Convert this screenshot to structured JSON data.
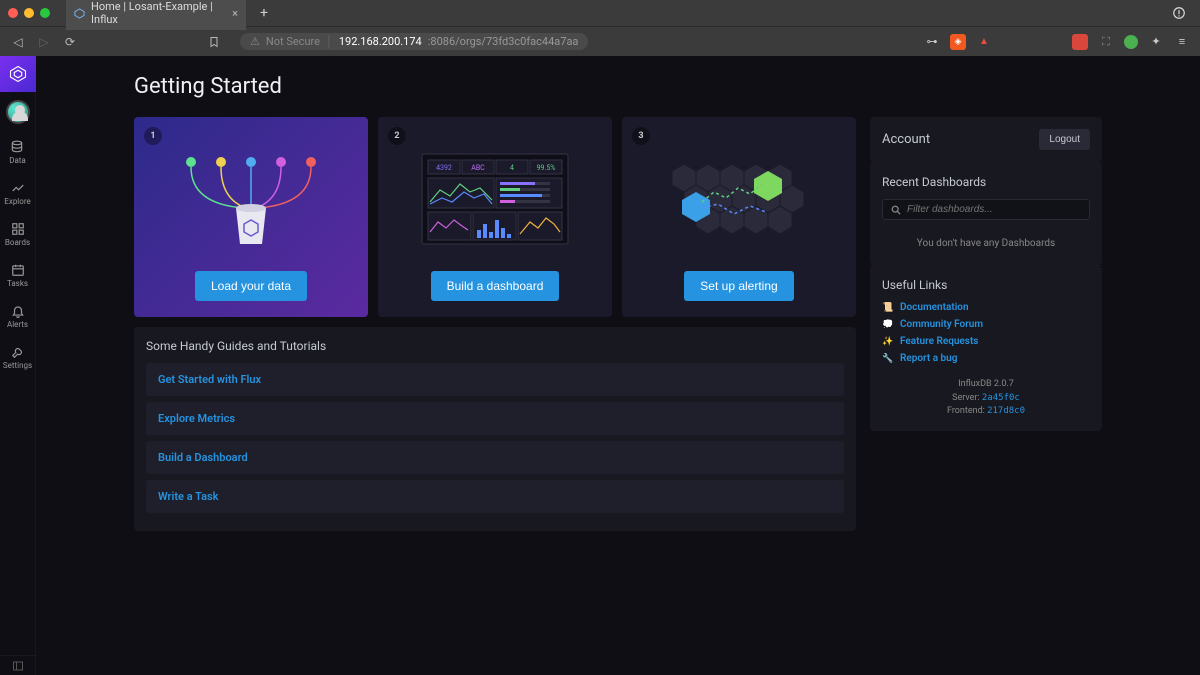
{
  "browser": {
    "tab_title": "Home | Losant-Example | Influx",
    "url_security": "Not Secure",
    "url_host": "192.168.200.174",
    "url_port_path": ":8086/orgs/73fd3c0fac44a7aa"
  },
  "sidebar": {
    "items": [
      {
        "label": "Data"
      },
      {
        "label": "Explore"
      },
      {
        "label": "Boards"
      },
      {
        "label": "Tasks"
      },
      {
        "label": "Alerts"
      },
      {
        "label": "Settings"
      }
    ]
  },
  "page": {
    "title": "Getting Started"
  },
  "cards": [
    {
      "num": "1",
      "button": "Load your data"
    },
    {
      "num": "2",
      "button": "Build a dashboard",
      "stats": {
        "a": "4392",
        "b": "ABC",
        "c": "4",
        "d": "99.5%"
      }
    },
    {
      "num": "3",
      "button": "Set up alerting"
    }
  ],
  "guides": {
    "title": "Some Handy Guides and Tutorials",
    "items": [
      "Get Started with Flux",
      "Explore Metrics",
      "Build a Dashboard",
      "Write a Task"
    ]
  },
  "account": {
    "label": "Account",
    "logout": "Logout"
  },
  "recent": {
    "title": "Recent Dashboards",
    "placeholder": "Filter dashboards...",
    "empty": "You don't have any Dashboards"
  },
  "links": {
    "title": "Useful Links",
    "items": [
      {
        "emoji": "📜",
        "label": "Documentation"
      },
      {
        "emoji": "💭",
        "label": "Community Forum"
      },
      {
        "emoji": "✨",
        "label": "Feature Requests"
      },
      {
        "emoji": "🔧",
        "label": "Report a bug"
      }
    ]
  },
  "version": {
    "product": "InfluxDB 2.0.7",
    "server_label": "Server: ",
    "server_hash": "2a45f0c",
    "frontend_label": "Frontend: ",
    "frontend_hash": "217d8c0"
  }
}
